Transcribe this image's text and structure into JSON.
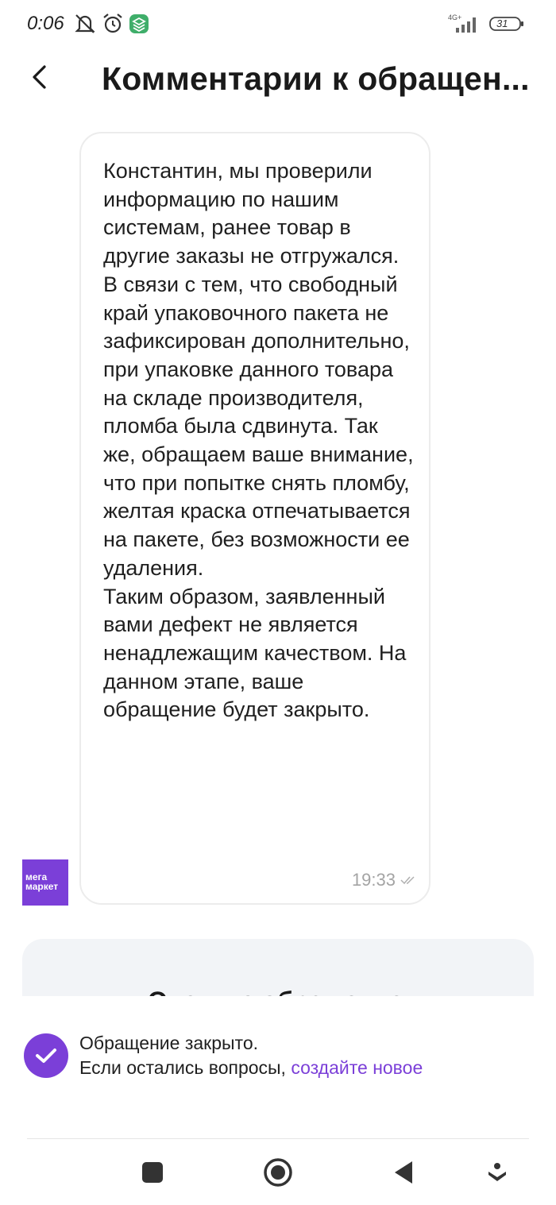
{
  "status_bar": {
    "time": "0:06",
    "network": "4G+",
    "battery": "31",
    "icons": [
      "mute-icon",
      "alarm-icon",
      "app-notification-icon",
      "signal-icon",
      "battery-icon"
    ]
  },
  "header": {
    "back_icon": "chevron-left-icon",
    "title": "Комментарии к обращен..."
  },
  "message": {
    "text": "Константин, мы проверили информацию по нашим системам, ранее товар в другие заказы не отгружался. В связи с тем, что свободный край упаковочного пакета не зафиксирован дополнительно, при упаковке данного товара на складе производителя, пломба была сдвинута. Так же, обращаем ваше внимание, что при попытке снять пломбу, желтая краска отпечатывается на пакете, без возможности ее удаления.\nТаким образом, заявленный вами дефект не является ненадлежащим качеством. На данном этапе, ваше обращение будет закрыто.",
    "time": "19:33",
    "status_icon": "double-check-icon"
  },
  "sender": {
    "logo_line1": "мега",
    "logo_line2": "маркет"
  },
  "card": {
    "partial_text": "Оцените обращение"
  },
  "closed_notice": {
    "title": "Обращение закрыто.",
    "prefix": "Если остались вопросы, ",
    "link": "создайте новое"
  },
  "navigation": [
    "recents-button",
    "home-button",
    "back-button",
    "assistant-button"
  ],
  "colors": {
    "accent": "#7b3fd8",
    "bubble_border": "#ececec",
    "card_bg": "#f2f4f7",
    "time_text": "#a4a4a4"
  }
}
